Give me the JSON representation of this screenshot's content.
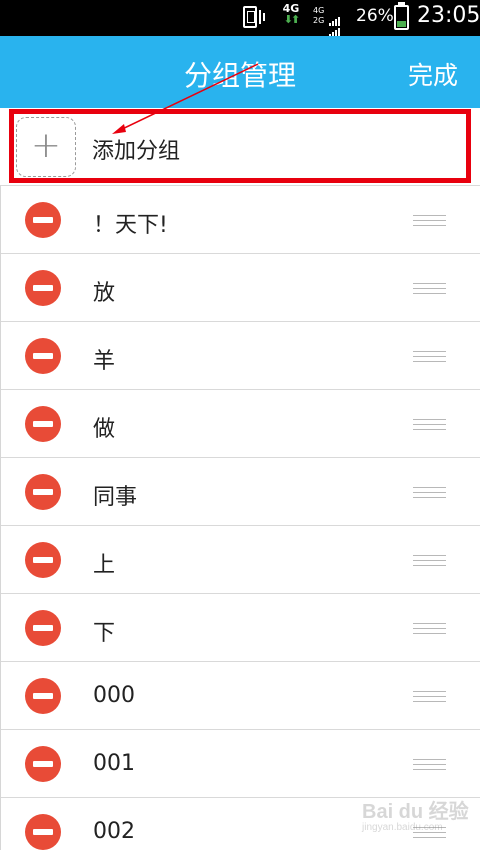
{
  "status_bar": {
    "network_4g": "4G",
    "dual_signal_top": "4G",
    "dual_signal_bottom": "2G",
    "battery_percent": "26%",
    "battery_level": 0.26,
    "time": "23:05"
  },
  "header": {
    "title": "分组管理",
    "done_label": "完成"
  },
  "add_group": {
    "icon": "plus-icon",
    "label": "添加分组"
  },
  "groups": [
    {
      "label": "！天下!"
    },
    {
      "label": "放"
    },
    {
      "label": "羊"
    },
    {
      "label": "做"
    },
    {
      "label": "同事"
    },
    {
      "label": "上"
    },
    {
      "label": "下"
    },
    {
      "label": "000"
    },
    {
      "label": "001"
    },
    {
      "label": "002"
    }
  ],
  "watermark": {
    "text": "Bai du 经验",
    "sub": "jingyan.baidu.com"
  },
  "colors": {
    "header_bg": "#29b3ee",
    "highlight_border": "#e8000e",
    "delete_button": "#e84b37"
  }
}
